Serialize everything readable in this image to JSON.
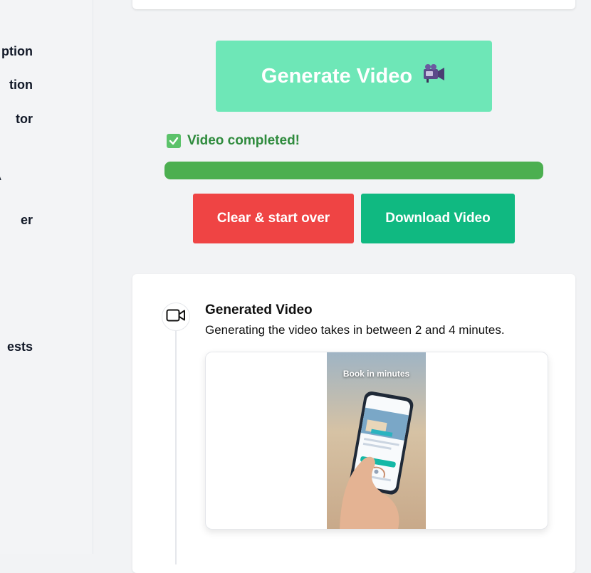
{
  "sidebar": {
    "items": [
      {
        "label": "Description",
        "visible": "ption"
      },
      {
        "label": "Location",
        "visible": "tion"
      },
      {
        "label": "Editor",
        "visible": "tor"
      },
      {
        "label": "A",
        "visible": "A"
      },
      {
        "label": "Over",
        "visible": "er"
      },
      {
        "label": "Requests",
        "visible": "ests"
      }
    ]
  },
  "generate": {
    "label": "Generate Video",
    "icon": "video-camera-icon"
  },
  "status": {
    "text": "Video completed!",
    "icon": "check-box-icon",
    "color": "#2f8b3d"
  },
  "progress": {
    "percent": 100,
    "color": "#4caf50"
  },
  "actions": {
    "clear_label": "Clear & start over",
    "download_label": "Download Video",
    "clear_color": "#ef4444",
    "download_color": "#10b981"
  },
  "generated": {
    "title": "Generated Video",
    "description": "Generating the video takes in between 2 and 4 minutes.",
    "icon": "video-icon",
    "video_caption": "Book in minutes"
  }
}
